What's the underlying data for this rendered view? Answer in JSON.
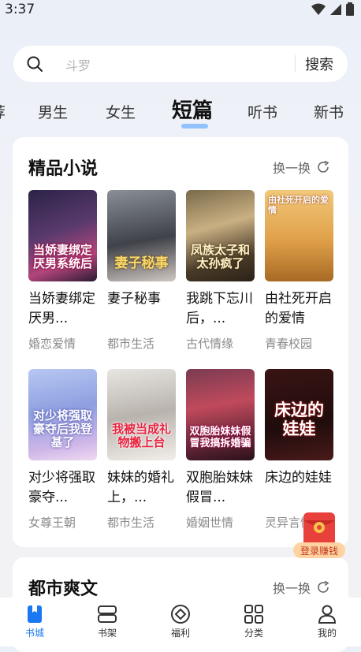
{
  "status_bar": {
    "time": "3:37"
  },
  "search": {
    "placeholder": "斗罗",
    "button": "搜索"
  },
  "tabs": [
    {
      "label": "荐"
    },
    {
      "label": "男生"
    },
    {
      "label": "女生"
    },
    {
      "label": "短篇",
      "active": true
    },
    {
      "label": "听书"
    },
    {
      "label": "新书"
    }
  ],
  "section1": {
    "title": "精品小说",
    "swap_label": "换一换",
    "books": [
      {
        "title": "当娇妻绑定厌男系统后",
        "title_display": "当娇妻绑定厌男...",
        "genre": "婚恋爱情",
        "cover_text": "当娇妻绑定厌男系统后"
      },
      {
        "title": "妻子秘事",
        "title_display": "妻子秘事",
        "genre": "都市生活",
        "cover_text": "妻子秘事"
      },
      {
        "title": "我跳下忘川后，…",
        "title_display": "我跳下忘川后，...",
        "genre": "古代情缘",
        "cover_text": "凤族太子和太孙疯了"
      },
      {
        "title": "由社死开启的爱情",
        "title_display": "由社死开启的爱情",
        "genre": "青春校园",
        "cover_text": "由社死开启的爱情"
      },
      {
        "title": "对少将强取豪夺…",
        "title_display": "对少将强取豪夺...",
        "genre": "女尊王朝",
        "cover_text": "对少将强取豪夺后我登基了"
      },
      {
        "title": "妹妹的婚礼上，…",
        "title_display": "妹妹的婚礼上，...",
        "genre": "都市生活",
        "cover_text": "我被当成礼物搬上台"
      },
      {
        "title": "双胞胎妹妹假冒…",
        "title_display": "双胞胎妹妹假冒...",
        "genre": "婚姻世情",
        "cover_text": "双胞胎妹妹假冒我搞拆婚骗"
      },
      {
        "title": "床边的娃娃",
        "title_display": "床边的娃娃",
        "genre": "灵异言情",
        "cover_text": "床边的娃娃"
      }
    ]
  },
  "section2": {
    "title": "都市爽文",
    "swap_label": "换一换"
  },
  "float_badge": {
    "label": "登录赚钱"
  },
  "bottom_nav": [
    {
      "label": "书城",
      "active": true,
      "icon": "bookstore-icon"
    },
    {
      "label": "书架",
      "icon": "bookshelf-icon"
    },
    {
      "label": "福利",
      "icon": "welfare-icon"
    },
    {
      "label": "分类",
      "icon": "category-icon"
    },
    {
      "label": "我的",
      "icon": "profile-icon"
    }
  ],
  "colors": {
    "accent": "#1a78f2",
    "tab_underline": "#7ab6ff",
    "red_packet": "#e8403a"
  }
}
